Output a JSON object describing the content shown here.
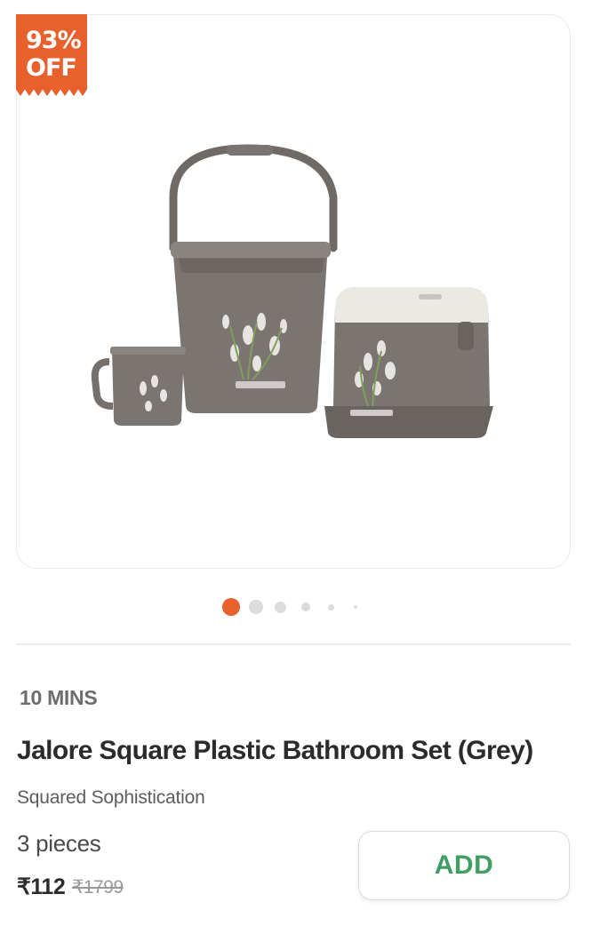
{
  "badge": {
    "line1": "93%",
    "line2": "OFF",
    "color": "#e8602c"
  },
  "product_image": {
    "icon": "bathroom-set-image",
    "slide_count": 6,
    "active_slide": 1,
    "active_color": "#e8602c"
  },
  "delivery": {
    "eta": "10 MINS"
  },
  "product": {
    "title": "Jalore Square Plastic Bathroom Set (Grey)",
    "subtitle": "Squared Sophistication",
    "quantity": "3 pieces",
    "price": "₹112",
    "mrp": "₹1799"
  },
  "cta": {
    "label": "ADD",
    "color": "#3f9f63"
  }
}
